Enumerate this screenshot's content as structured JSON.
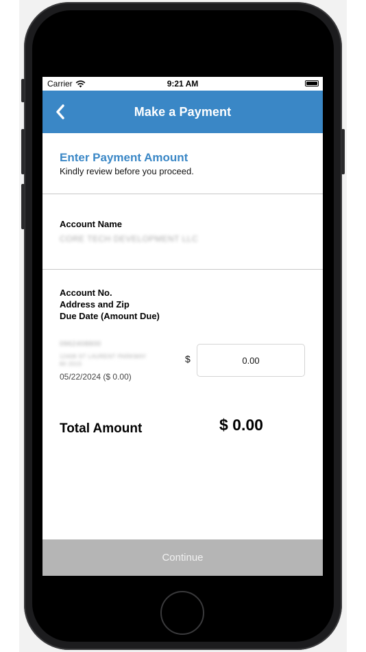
{
  "status_bar": {
    "carrier": "Carrier",
    "time": "9:21 AM",
    "icons": [
      "wifi-icon",
      "battery-icon"
    ]
  },
  "nav": {
    "title": "Make a Payment",
    "back_icon": "chevron-left-icon"
  },
  "section": {
    "heading": "Enter Payment Amount",
    "subheading": "Kindly review before you proceed."
  },
  "account": {
    "name_label": "Account Name",
    "name_value": "CORE TECH DEVELOPMENT LLC",
    "number_label": "Account No.",
    "address_label": "Address and Zip",
    "due_label": "Due Date (Amount Due)",
    "number_value": "0962408800",
    "address_value": "12408 ST LAURENT PARKWAY",
    "address_zip": "80 2015",
    "due_value": "05/22/2024 ($ 0.00)"
  },
  "payment": {
    "currency_symbol": "$",
    "amount_value": "0.00"
  },
  "total": {
    "label": "Total Amount",
    "value": "$ 0.00"
  },
  "actions": {
    "continue_label": "Continue"
  },
  "colors": {
    "accent": "#3a87c6",
    "button_disabled": "#b5b5b5",
    "divider": "#c8c8c8"
  }
}
